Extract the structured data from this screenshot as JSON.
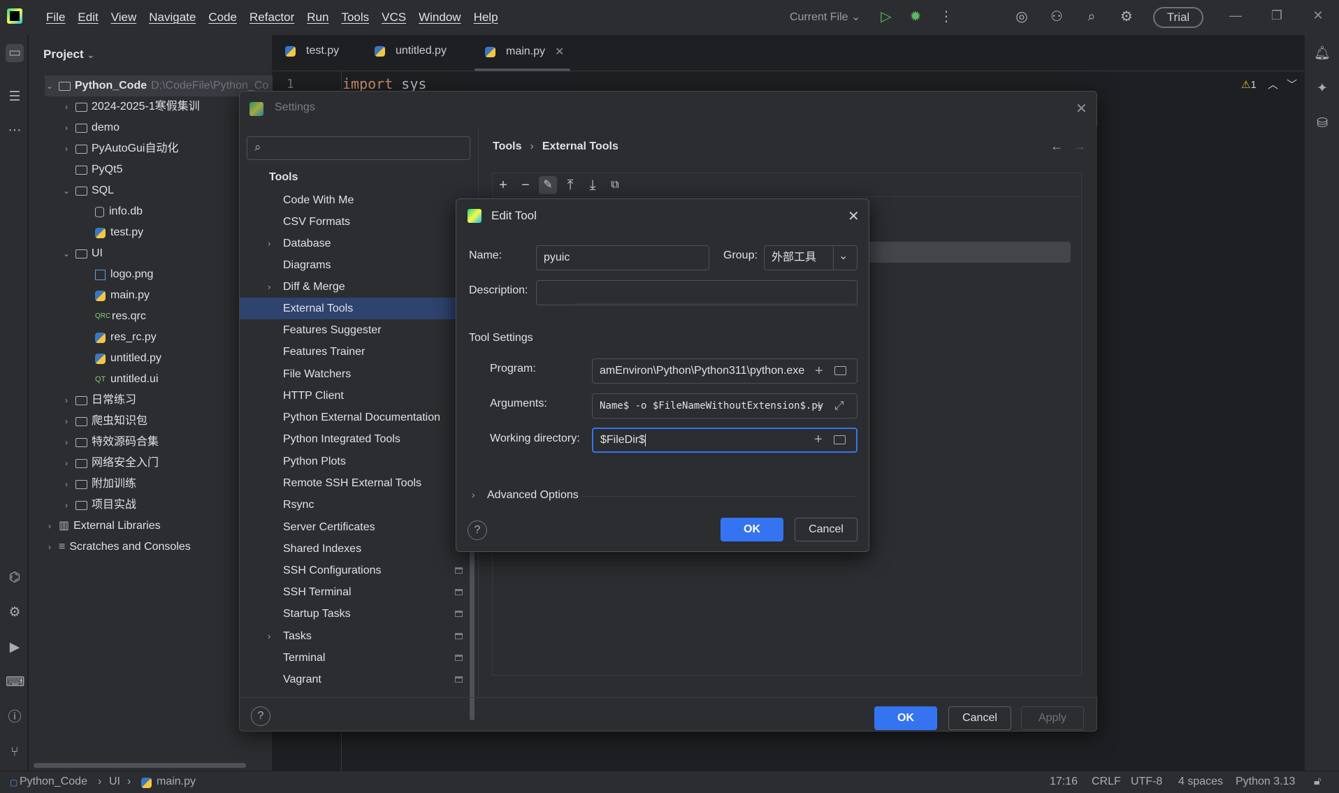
{
  "menu": [
    "File",
    "Edit",
    "View",
    "Navigate",
    "Code",
    "Refactor",
    "Run",
    "Tools",
    "VCS",
    "Window",
    "Help"
  ],
  "toolbar": {
    "run_config": "Current File",
    "trial": "Trial"
  },
  "project": {
    "header": "Project",
    "root_name": "Python_Code",
    "root_path": "D:\\CodeFile\\Python_Co",
    "items": [
      "2024-2025-1寒假集训",
      "demo",
      "PyAutoGui自动化",
      "PyQt5",
      "SQL",
      "info.db",
      "test.py",
      "UI",
      "logo.png",
      "main.py",
      "res.qrc",
      "res_rc.py",
      "untitled.py",
      "untitled.ui",
      "日常练习",
      "爬虫知识包",
      "特效源码合集",
      "网络安全入门",
      "附加训练",
      "项目实战",
      "External Libraries",
      "Scratches and Consoles"
    ],
    "qrc_tag": "QRC",
    "ui_tag": "QT"
  },
  "editor": {
    "tabs": [
      "test.py",
      "untitled.py",
      "main.py"
    ],
    "line_number": "1",
    "code_keyword": "import",
    "code_rest": " sys",
    "warning_count": "1"
  },
  "settings": {
    "title": "Settings",
    "section": "Tools",
    "items": [
      "Code With Me",
      "CSV Formats",
      "Database",
      "Diagrams",
      "Diff & Merge",
      "External Tools",
      "Features Suggester",
      "Features Trainer",
      "File Watchers",
      "HTTP Client",
      "Python External Documentation",
      "Python Integrated Tools",
      "Python Plots",
      "Remote SSH External Tools",
      "Rsync",
      "Server Certificates",
      "Shared Indexes",
      "SSH Configurations",
      "SSH Terminal",
      "Startup Tasks",
      "Tasks",
      "Terminal",
      "Vagrant"
    ],
    "breadcrumb_parent": "Tools",
    "breadcrumb_current": "External Tools",
    "ok": "OK",
    "cancel": "Cancel",
    "apply": "Apply"
  },
  "edit_tool": {
    "title": "Edit Tool",
    "name_label": "Name:",
    "name_value": "pyuic",
    "group_label": "Group:",
    "group_value": "外部工具",
    "description_label": "Description:",
    "description_value": "",
    "tool_settings": "Tool Settings",
    "program_label": "Program:",
    "program_value": "amEnviron\\Python\\Python311\\python.exe",
    "arguments_label": "Arguments:",
    "arguments_value": "Name$ -o $FileNameWithoutExtension$.py",
    "workdir_label": "Working directory:",
    "workdir_value": "$FileDir$",
    "advanced": "Advanced Options",
    "ok": "OK",
    "cancel": "Cancel"
  },
  "status": {
    "crumb_root": "Python_Code",
    "crumb_dir": "UI",
    "crumb_file": "main.py",
    "position": "17:16",
    "line_sep": "CRLF",
    "encoding": "UTF-8",
    "indent": "4 spaces",
    "interpreter": "Python 3.13"
  },
  "colors": {
    "accent": "#3574f0",
    "selection": "#2e436e",
    "keyword": "#cf8e6d"
  }
}
